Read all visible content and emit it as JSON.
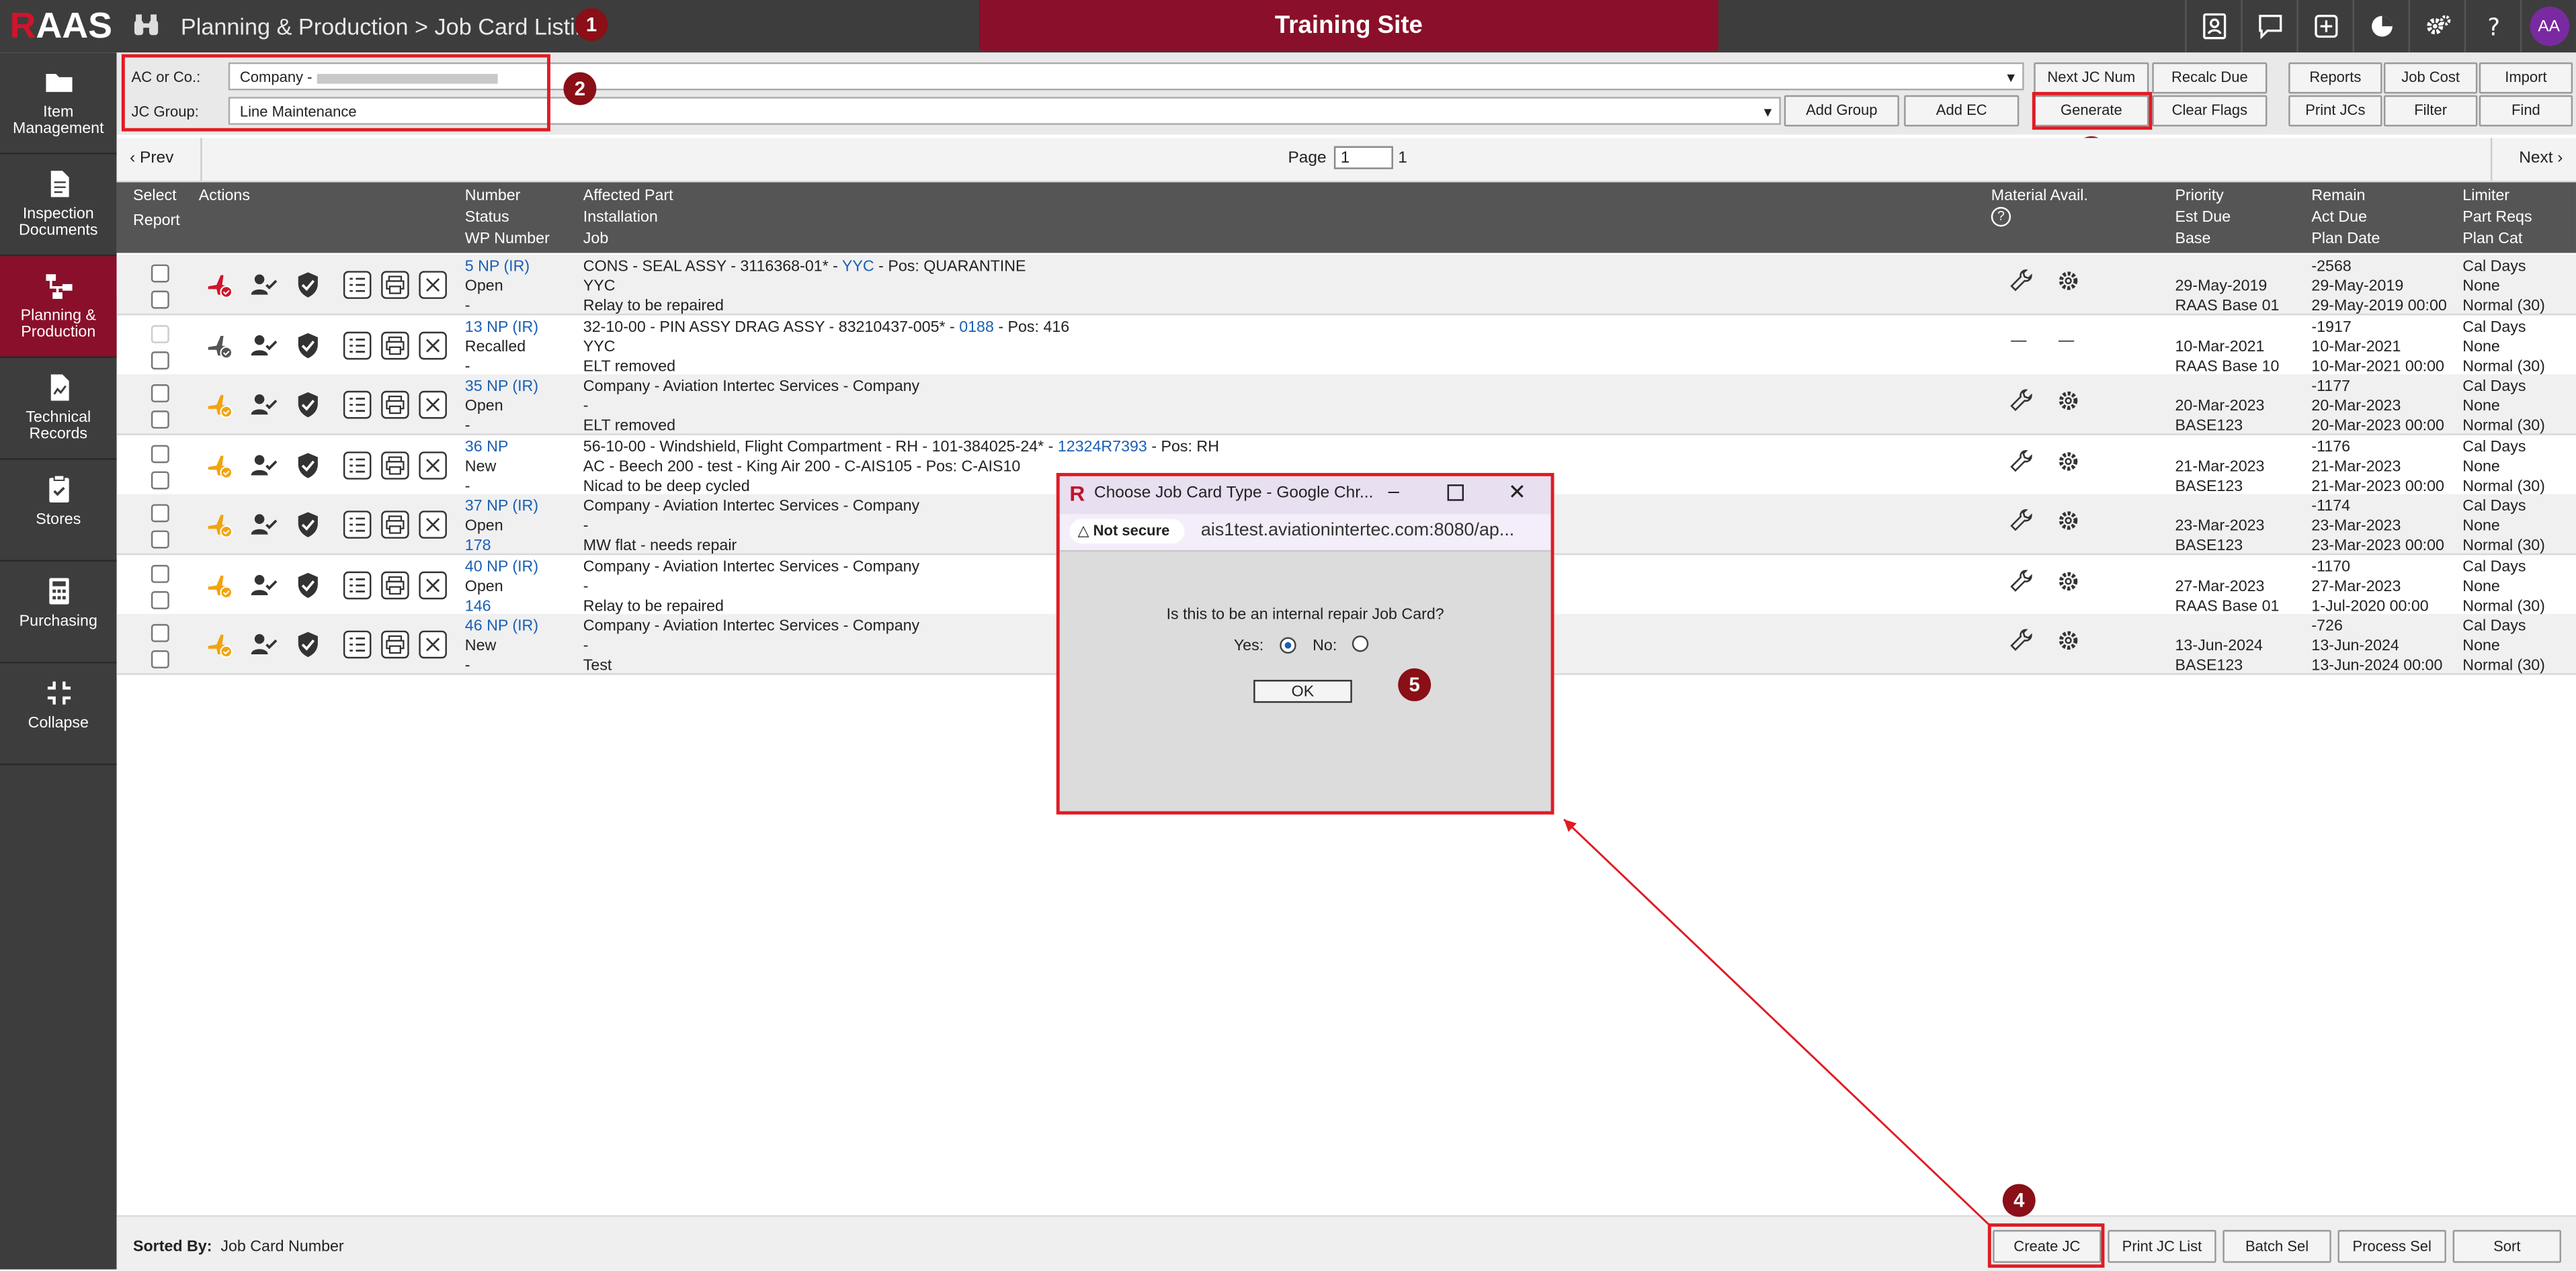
{
  "app": {
    "logo_r": "R",
    "logo_rest": "AAS",
    "breadcrumb": "Planning & Production > Job Card Listing",
    "site_banner": "Training Site",
    "avatar_initials": "AA"
  },
  "sidebar": {
    "items": [
      {
        "label": "Item Management",
        "icon": "folder-icon"
      },
      {
        "label": "Inspection Documents",
        "icon": "document-icon"
      },
      {
        "label": "Planning & Production",
        "icon": "workflow-icon",
        "active": true
      },
      {
        "label": "Technical Records",
        "icon": "chart-document-icon"
      },
      {
        "label": "Stores",
        "icon": "clipboard-check-icon"
      },
      {
        "label": "Purchasing",
        "icon": "calculator-icon"
      },
      {
        "label": "Collapse",
        "icon": "collapse-icon"
      }
    ]
  },
  "filter": {
    "ac_label": "AC or Co.:",
    "ac_value": "Company - ",
    "group_label": "JC Group:",
    "group_value": "Line Maintenance",
    "buttons": {
      "add_group": "Add Group",
      "add_ec": "Add EC",
      "next_jc_num": "Next JC Num",
      "generate": "Generate",
      "recalc_due": "Recalc Due",
      "clear_flags": "Clear Flags",
      "reports": "Reports",
      "job_cost": "Job Cost",
      "import": "Import",
      "print_jcs": "Print JCs",
      "filter": "Filter",
      "find": "Find"
    }
  },
  "pager": {
    "prev": "Prev",
    "page_label": "Page",
    "page_value": "1",
    "page_total": "1",
    "next": "Next"
  },
  "table_header": {
    "select": "Select",
    "report": "Report",
    "actions": "Actions",
    "number": "Number",
    "status": "Status",
    "wp_number": "WP Number",
    "affected_part": "Affected Part",
    "installation": "Installation",
    "job": "Job",
    "material_avail": "Material Avail.",
    "priority": "Priority",
    "est_due": "Est Due",
    "base": "Base",
    "remain": "Remain",
    "act_due": "Act Due",
    "plan_date": "Plan Date",
    "limiter": "Limiter",
    "part_reqs": "Part Reqs",
    "plan_cat": "Plan Cat"
  },
  "rows": [
    {
      "number": "5 NP (IR)",
      "status": "Open",
      "wp": "-",
      "part_pre": "CONS - SEAL ASSY - 3116368-01* - ",
      "part_link": "YYC",
      "part_post": " - Pos: QUARANTINE",
      "install": "YYC",
      "job": "Relay to be repaired",
      "est_due": "29-May-2019",
      "base": "RAAS Base 01",
      "remain": "-2568",
      "act_due": "29-May-2019",
      "plan_date": "29-May-2019 00:00",
      "limiter": "Cal Days",
      "part_reqs": "None",
      "plan_cat": "Normal (30)",
      "material": "tools",
      "plane": "red"
    },
    {
      "number": "13 NP (IR)",
      "status": "Recalled",
      "wp": "-",
      "part_pre": "32-10-00 - PIN ASSY DRAG ASSY - 83210437-005* - ",
      "part_link": "0188",
      "part_post": " - Pos: 416",
      "install": "YYC",
      "job": "ELT removed",
      "est_due": "10-Mar-2021",
      "base": "RAAS Base 10",
      "remain": "-1917",
      "act_due": "10-Mar-2021",
      "plan_date": "10-Mar-2021 00:00",
      "limiter": "Cal Days",
      "part_reqs": "None",
      "plan_cat": "Normal (30)",
      "material": "dash",
      "plane": "gray"
    },
    {
      "number": "35 NP (IR)",
      "status": "Open",
      "wp": "-",
      "part_pre": "Company - Aviation Intertec Services - Company",
      "part_link": "",
      "part_post": "",
      "install": "-",
      "job": "ELT removed",
      "est_due": "20-Mar-2023",
      "base": "BASE123",
      "remain": "-1177",
      "act_due": "20-Mar-2023",
      "plan_date": "20-Mar-2023 00:00",
      "limiter": "Cal Days",
      "part_reqs": "None",
      "plan_cat": "Normal (30)",
      "material": "tools",
      "plane": "orange"
    },
    {
      "number": "36 NP",
      "status": "New",
      "wp": "-",
      "part_pre": "56-10-00 - Windshield, Flight Compartment - RH - 101-384025-24* - ",
      "part_link": "12324R7393",
      "part_post": " - Pos: RH",
      "install": "AC - Beech 200 - test - King Air 200 - C-AIS105 - Pos: C-AIS10",
      "job": "Nicad to be deep cycled",
      "est_due": "21-Mar-2023",
      "base": "BASE123",
      "remain": "-1176",
      "act_due": "21-Mar-2023",
      "plan_date": "21-Mar-2023 00:00",
      "limiter": "Cal Days",
      "part_reqs": "None",
      "plan_cat": "Normal (30)",
      "material": "tools",
      "plane": "orange"
    },
    {
      "number": "37 NP (IR)",
      "status": "Open",
      "wp": "178",
      "part_pre": "Company - Aviation Intertec Services - Company",
      "part_link": "",
      "part_post": "",
      "install": "-",
      "job": "MW flat - needs repair",
      "est_due": "23-Mar-2023",
      "base": "BASE123",
      "remain": "-1174",
      "act_due": "23-Mar-2023",
      "plan_date": "23-Mar-2023 00:00",
      "limiter": "Cal Days",
      "part_reqs": "None",
      "plan_cat": "Normal (30)",
      "material": "tools",
      "plane": "orange"
    },
    {
      "number": "40 NP (IR)",
      "status": "Open",
      "wp": "146",
      "part_pre": "Company - Aviation Intertec Services - Company",
      "part_link": "",
      "part_post": "",
      "install": "-",
      "job": "Relay to be repaired",
      "est_due": "27-Mar-2023",
      "base": "RAAS Base 01",
      "remain": "-1170",
      "act_due": "27-Mar-2023",
      "plan_date": "1-Jul-2020 00:00",
      "limiter": "Cal Days",
      "part_reqs": "None",
      "plan_cat": "Normal (30)",
      "material": "tools",
      "plane": "orange"
    },
    {
      "number": "46 NP (IR)",
      "status": "New",
      "wp": "-",
      "part_pre": "Company - Aviation Intertec Services - Company",
      "part_link": "",
      "part_post": "",
      "install": "-",
      "job": "Test",
      "est_due": "13-Jun-2024",
      "base": "BASE123",
      "remain": "-726",
      "act_due": "13-Jun-2024",
      "plan_date": "13-Jun-2024 00:00",
      "limiter": "Cal Days",
      "part_reqs": "None",
      "plan_cat": "Normal (30)",
      "material": "tools",
      "plane": "orange"
    }
  ],
  "bottom": {
    "sorted_label": "Sorted By:",
    "sorted_value": "Job Card Number",
    "create_jc": "Create JC",
    "print_jc_list": "Print JC List",
    "batch_sel": "Batch Sel",
    "process_sel": "Process Sel",
    "sort": "Sort"
  },
  "dialog": {
    "title": "Choose Job Card Type - Google Chr...",
    "not_secure": "Not secure",
    "url": "ais1test.aviationintertec.com:8080/ap...",
    "question": "Is this to be an internal repair Job Card?",
    "yes_label": "Yes:",
    "no_label": "No:",
    "ok": "OK"
  },
  "annotations": [
    "1",
    "2",
    "3",
    "4",
    "5"
  ],
  "colors": {
    "brand_red": "#8a0f2a",
    "highlight_red": "#e01b24",
    "link_blue": "#1a5fb4",
    "sidebar": "#3d3d3d"
  }
}
